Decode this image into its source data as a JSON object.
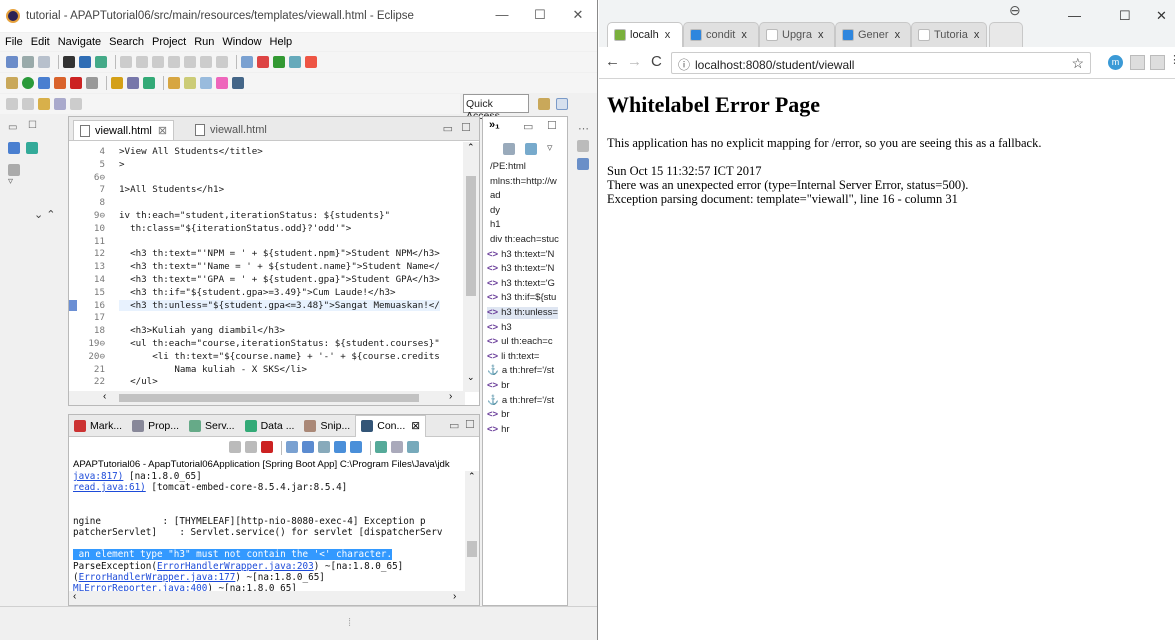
{
  "eclipse": {
    "title": "tutorial - APAPTutorial06/src/main/resources/templates/viewall.html - Eclipse",
    "menu": [
      "File",
      "Edit",
      "Navigate",
      "Search",
      "Project",
      "Run",
      "Window",
      "Help"
    ],
    "quick_access": "Quick Access",
    "editor": {
      "tabs": [
        {
          "label": "viewall.html",
          "close": "⊠"
        },
        {
          "label": "viewall.html"
        }
      ],
      "line_numbers": [
        "4",
        "5",
        "6⊖",
        "7",
        "8",
        "9⊖",
        "10",
        "11",
        "12",
        "13",
        "14",
        "15",
        "16",
        "17",
        "18",
        "19⊖",
        "20⊖",
        "21",
        "22"
      ],
      "lines": [
        ">View All Students</title>",
        ">",
        "",
        "1>All Students</h1>",
        "",
        "iv th:each=\"student,iterationStatus: ${students}\"",
        "  th:class=\"${iterationStatus.odd}?'odd'\">",
        "",
        "  <h3 th:text=\"'NPM = ' + ${student.npm}\">Student NPM</h3>",
        "  <h3 th:text=\"'Name = ' + ${student.name}\">Student Name</",
        "  <h3 th:text=\"'GPA = ' + ${student.gpa}\">Student GPA</h3>",
        "  <h3 th:if=\"${student.gpa>=3.49}\">Cum Laude!</h3>",
        "  <h3 th:unless=\"${student.gpa<=3.48}\">Sangat Memuaskan!</",
        "",
        "  <h3>Kuliah yang diambil</h3>",
        "  <ul th:each=\"course,iterationStatus: ${student.courses}\"",
        "      <li th:text=\"${course.name} + '-' + ${course.credits",
        "          Nama kuliah - X SKS</li>",
        "  </ul>"
      ]
    },
    "outline": {
      "header": "»₁",
      "items": [
        {
          "tag": "",
          "text": "/PE:html"
        },
        {
          "tag": "",
          "text": "mlns:th=http://w"
        },
        {
          "tag": "",
          "text": "ad"
        },
        {
          "tag": "",
          "text": "dy"
        },
        {
          "tag": "",
          "text": "h1"
        },
        {
          "tag": "",
          "text": "div th:each=stuc"
        },
        {
          "tag": "<>",
          "text": "h3 th:text='N"
        },
        {
          "tag": "<>",
          "text": "h3 th:text='N"
        },
        {
          "tag": "<>",
          "text": "h3 th:text='G"
        },
        {
          "tag": "<>",
          "text": "h3 th:if=${stu"
        },
        {
          "tag": "<>",
          "text": "h3 th:unless="
        },
        {
          "tag": "<>",
          "text": "h3"
        },
        {
          "tag": "<>",
          "text": "ul th:each=c"
        },
        {
          "tag": "<>",
          "text": "li th:text="
        },
        {
          "tag": "⚓",
          "text": "a th:href='/st"
        },
        {
          "tag": "<>",
          "text": "br"
        },
        {
          "tag": "⚓",
          "text": "a th:href='/st"
        },
        {
          "tag": "<>",
          "text": "br"
        },
        {
          "tag": "<>",
          "text": "hr"
        }
      ]
    },
    "console": {
      "tabs": [
        "Mark...",
        "Prop...",
        "Serv...",
        "Data ...",
        "Snip...",
        "Con..."
      ],
      "close": "⊠",
      "launch": "APAPTutorial06 - ApapTutorial06Application [Spring Boot App] C:\\Program Files\\Java\\jdk",
      "lines": [
        {
          "pre": "",
          "link": "java:817)",
          "post": " [na:1.8.0_65]"
        },
        {
          "pre": "",
          "link": "read.java:61)",
          "post": " [tomcat-embed-core-8.5.4.jar:8.5.4]"
        },
        {
          "pre": "",
          "link": "",
          "post": ""
        },
        {
          "pre": "",
          "link": "",
          "post": ""
        },
        {
          "pre": "ngine           : [THYMELEAF][http-nio-8080-exec-4] Exception p",
          "link": "",
          "post": ""
        },
        {
          "pre": "patcherServlet]    : Servlet.service() for servlet [dispatcherServ",
          "link": "",
          "post": ""
        },
        {
          "pre": "",
          "link": "",
          "post": ""
        },
        {
          "sel": " an element type \"h3\" must not contain the '<' character."
        },
        {
          "pre": "ParseException(",
          "link": "ErrorHandlerWrapper.java:203",
          "post": ") ~[na:1.8.0_65]"
        },
        {
          "pre": "(",
          "link": "ErrorHandlerWrapper.java:177",
          "post": ") ~[na:1.8.0_65]"
        },
        {
          "pre": "",
          "link": "MLErrorReporter.java:400",
          "post": ") ~[na:1.8.0_65]"
        }
      ]
    }
  },
  "chrome": {
    "tabs": [
      {
        "label": "localh",
        "close": "x",
        "active": true
      },
      {
        "label": "condit",
        "close": "x"
      },
      {
        "label": "Upgra",
        "close": "x"
      },
      {
        "label": "Gener",
        "close": "x"
      },
      {
        "label": "Tutoria",
        "close": "x"
      }
    ],
    "url": "localhost:8080/student/viewall",
    "page": {
      "heading": "Whitelabel Error Page",
      "message": "This application has no explicit mapping for /error, so you are seeing this as a fallback.",
      "timestamp": "Sun Oct 15 11:32:57 ICT 2017",
      "error": "There was an unexpected error (type=Internal Server Error, status=500).",
      "detail": "Exception parsing document: template=\"viewall\", line 16 - column 31"
    }
  },
  "colors": {
    "accent": "#3399ff",
    "link": "#1d4bd9",
    "keyword": "#6a3e9a"
  }
}
